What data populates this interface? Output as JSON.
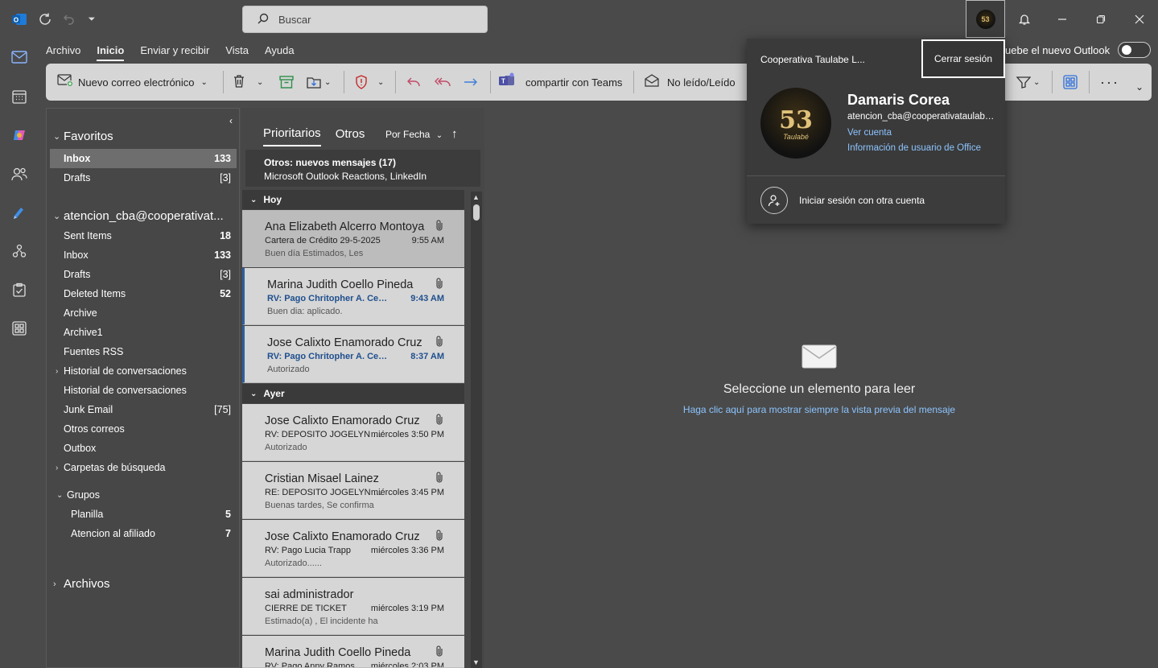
{
  "titlebar": {
    "search_placeholder": "Buscar",
    "avatar_initials": "53"
  },
  "menu": {
    "tabs": [
      "Archivo",
      "Inicio",
      "Enviar y recibir",
      "Vista",
      "Ayuda"
    ],
    "active": "Inicio",
    "try_new_outlook": "uebe el nuevo Outlook"
  },
  "ribbon": {
    "new_email": "Nuevo correo electrónico",
    "share_teams": "compartir con Teams",
    "unread_read": "No leído/Leído"
  },
  "folders": {
    "favorites_header": "Favoritos",
    "favorites": [
      {
        "name": "Inbox",
        "count": "133"
      },
      {
        "name": "Drafts",
        "count": "[3]"
      }
    ],
    "account_header": "atencion_cba@cooperativat...",
    "items": [
      {
        "name": "Sent Items",
        "count": "18"
      },
      {
        "name": "Inbox",
        "count": "133"
      },
      {
        "name": "Drafts",
        "count": "[3]"
      },
      {
        "name": "Deleted Items",
        "count": "52"
      },
      {
        "name": "Archive",
        "count": ""
      },
      {
        "name": "Archive1",
        "count": ""
      },
      {
        "name": "Fuentes RSS",
        "count": ""
      },
      {
        "name": "Historial de conversaciones",
        "count": ""
      },
      {
        "name": "Historial de conversaciones",
        "count": ""
      },
      {
        "name": "Junk Email",
        "count": "[75]"
      },
      {
        "name": "Otros correos",
        "count": ""
      },
      {
        "name": "Outbox",
        "count": ""
      },
      {
        "name": "Carpetas de búsqueda",
        "count": ""
      }
    ],
    "groups_header": "Grupos",
    "groups": [
      {
        "name": "Planilla",
        "count": "5"
      },
      {
        "name": "Atencion al afiliado",
        "count": "7"
      }
    ],
    "archives_header": "Archivos"
  },
  "list": {
    "tab_focused": "Prioritarios",
    "tab_other": "Otros",
    "sort_label": "Por Fecha",
    "others_title": "Otros: nuevos mensajes (17)",
    "others_senders": "Microsoft Outlook Reactions, LinkedIn",
    "group_today": "Hoy",
    "group_yesterday": "Ayer",
    "messages": [
      {
        "from": "Ana Elizabeth Alcerro Montoya",
        "subject": "Cartera de Crédito 29-5-2025",
        "time": "9:55 AM",
        "preview": "Buen día Estimados,  Les"
      },
      {
        "from": "Marina Judith Coello Pineda",
        "subject": "RV: Pago Chritopher A. Cerrato",
        "time": "9:43 AM",
        "preview": "Buen dia: aplicado."
      },
      {
        "from": "Jose Calixto Enamorado Cruz",
        "subject": "RV: Pago Chritopher A. Cerrato",
        "time": "8:37 AM",
        "preview": "Autorizado"
      },
      {
        "from": "Jose Calixto Enamorado Cruz",
        "subject": "RV: DEPOSITO JOGELYN JANETH",
        "time": "miércoles 3:50 PM",
        "preview": "Autorizado"
      },
      {
        "from": "Cristian Misael Lainez",
        "subject": "RE: DEPOSITO JOGELYN JANETH",
        "time": "miércoles 3:45 PM",
        "preview": "Buenas tardes,  Se confirma"
      },
      {
        "from": "Jose Calixto Enamorado Cruz",
        "subject": "RV: Pago Lucia Trapp",
        "time": "miércoles 3:36 PM",
        "preview": "Autorizado......"
      },
      {
        "from": "sai administrador",
        "subject": "CIERRE DE TICKET",
        "time": "miércoles 3:19 PM",
        "preview": "Estimado(a) , El incidente ha"
      },
      {
        "from": "Marina Judith Coello Pineda",
        "subject": "RV: Pago Anny Ramos",
        "time": "miércoles 2:03 PM",
        "preview": ""
      }
    ]
  },
  "reading": {
    "title": "Seleccione un elemento para leer",
    "link": "Haga clic aquí para mostrar siempre la vista previa del mensaje"
  },
  "account": {
    "org": "Cooperativa Taulabe L...",
    "signout": "Cerrar sesión",
    "avatar_number": "53",
    "avatar_script": "Taulabé",
    "name": "Damaris Corea",
    "email": "atencion_cba@cooperativataulabe.hn",
    "view_account": "Ver cuenta",
    "office_info": "Información de usuario de Office",
    "other_account": "Iniciar sesión con otra cuenta"
  },
  "colors": {
    "accent": "#8cc4ff",
    "unread": "#1f4f8e",
    "background": "#4a4a4a"
  }
}
